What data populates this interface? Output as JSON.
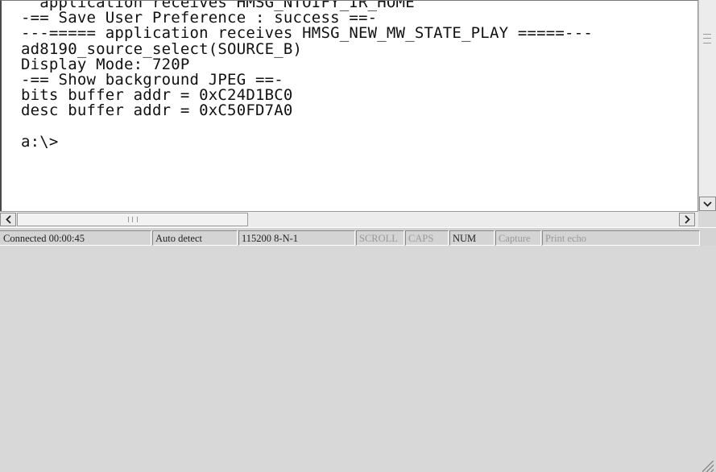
{
  "terminal": {
    "lines": [
      "  application receives HMSG_NTOIFY_IR_HOME",
      "-== Save User Preference : success ==-",
      "---===== application receives HMSG_NEW_MW_STATE_PLAY =====---",
      "ad8190_source_select(SOURCE_B)",
      "Display Mode: 720P",
      "-== Show background JPEG ==-",
      "bits buffer addr = 0xC24D1BC0",
      "desc buffer addr = 0xC50FD7A0",
      "",
      "a:\\>"
    ]
  },
  "statusbar": {
    "connection": "Connected 00:00:45",
    "detect": "Auto detect",
    "port_settings": "115200 8-N-1",
    "scroll": "SCROLL",
    "caps": "CAPS",
    "num": "NUM",
    "capture": "Capture",
    "print_echo": "Print echo"
  },
  "icons": [
    "down-arrow-icon",
    "left-arrow-icon",
    "right-arrow-icon",
    "resize-grip-icon"
  ],
  "colors": {
    "terminal_background": "#ffffff",
    "terminal_text": "#111111",
    "chrome": "#d4d4d4"
  }
}
